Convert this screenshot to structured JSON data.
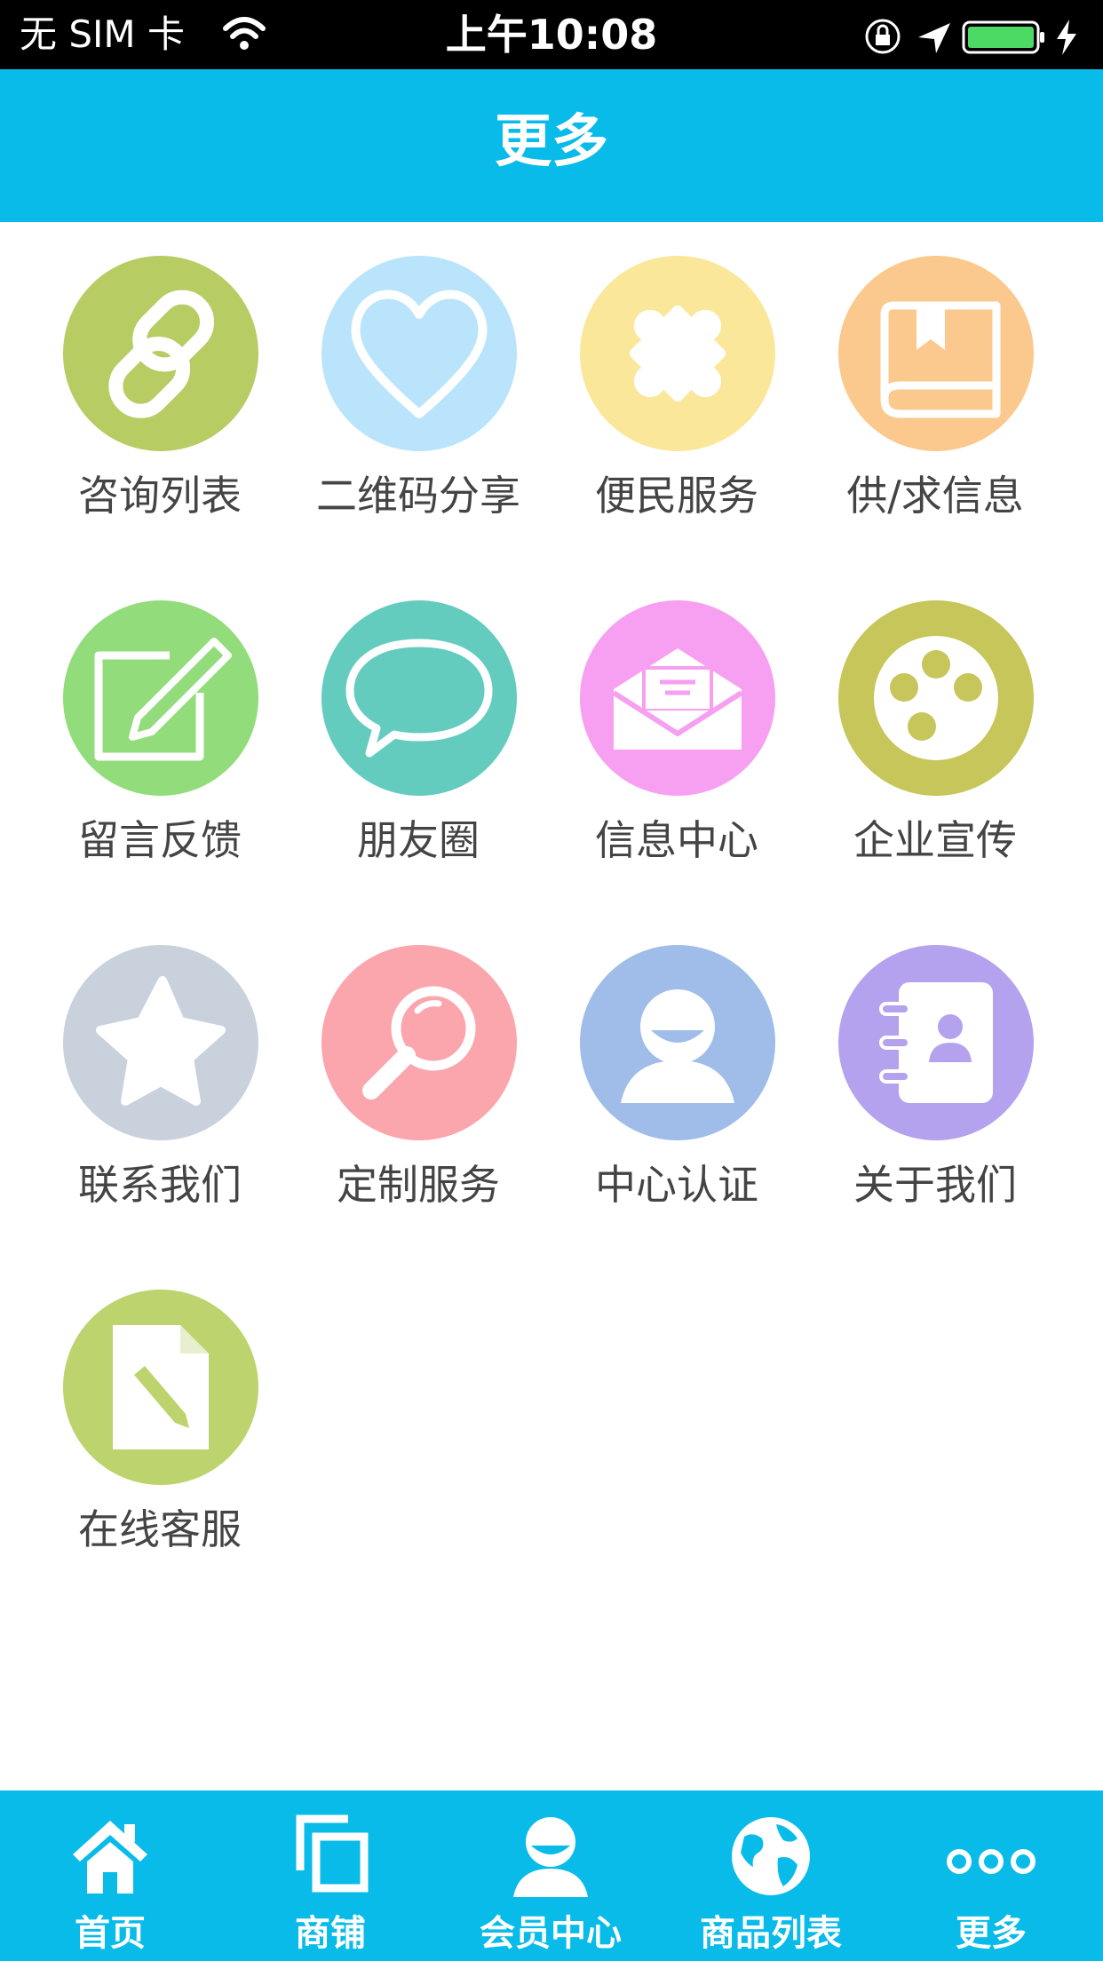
{
  "status_bar": {
    "carrier": "无 SIM 卡",
    "time": "上午10:08"
  },
  "header": {
    "title": "更多"
  },
  "menu": [
    {
      "label": "咨询列表",
      "icon": "link-icon",
      "color": "#b7cc63"
    },
    {
      "label": "二维码分享",
      "icon": "heart-icon",
      "color": "#b9e4fb"
    },
    {
      "label": "便民服务",
      "icon": "puzzle-icon",
      "color": "#fbe79a"
    },
    {
      "label": "供/求信息",
      "icon": "book-icon",
      "color": "#fbc98e"
    },
    {
      "label": "留言反馈",
      "icon": "edit-icon",
      "color": "#92dc7c"
    },
    {
      "label": "朋友圈",
      "icon": "chat-bubble-icon",
      "color": "#64ccbf"
    },
    {
      "label": "信息中心",
      "icon": "mail-icon",
      "color": "#f79ff0"
    },
    {
      "label": "企业宣传",
      "icon": "film-reel-icon",
      "color": "#c6c65a"
    },
    {
      "label": "联系我们",
      "icon": "star-icon",
      "color": "#c9d1dc"
    },
    {
      "label": "定制服务",
      "icon": "magnifier-icon",
      "color": "#fba5ad"
    },
    {
      "label": "中心认证",
      "icon": "user-icon",
      "color": "#9fbde8"
    },
    {
      "label": "关于我们",
      "icon": "contacts-book-icon",
      "color": "#b5a2ef"
    },
    {
      "label": "在线客服",
      "icon": "document-edit-icon",
      "color": "#bcd36e"
    }
  ],
  "tabs": [
    {
      "label": "首页",
      "icon": "home-icon"
    },
    {
      "label": "商铺",
      "icon": "store-icon"
    },
    {
      "label": "会员中心",
      "icon": "member-icon"
    },
    {
      "label": "商品列表",
      "icon": "globe-icon"
    },
    {
      "label": "更多",
      "icon": "more-icon"
    }
  ],
  "colors": {
    "accent": "#08bbe8",
    "label_text": "#444444"
  }
}
